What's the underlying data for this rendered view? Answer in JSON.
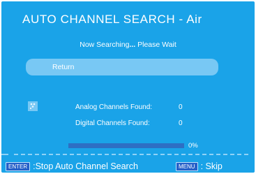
{
  "header": {
    "title": "AUTO CHANNEL SEARCH - Air"
  },
  "status": {
    "text": "Now Searching",
    "ellipsis": "...",
    "suffix": " Please Wait"
  },
  "return_button": {
    "label": "Return"
  },
  "counts": {
    "analog_label": "Analog Channels Found:",
    "analog_value": "0",
    "digital_label": "Digital Channels Found:",
    "digital_value": "0"
  },
  "progress": {
    "value": 0,
    "label": "0%"
  },
  "footer": {
    "enter_key": "ENTER",
    "enter_action": ":Stop Auto Channel Search",
    "menu_key": "MENU",
    "menu_action": ": Skip"
  },
  "icons": {
    "scan": "scan-signal-icon"
  },
  "colors": {
    "background": "#1aa3e8",
    "button": "#78c8f4",
    "progress_track": "#2d6fc4",
    "key_badge": "#2560c9"
  }
}
